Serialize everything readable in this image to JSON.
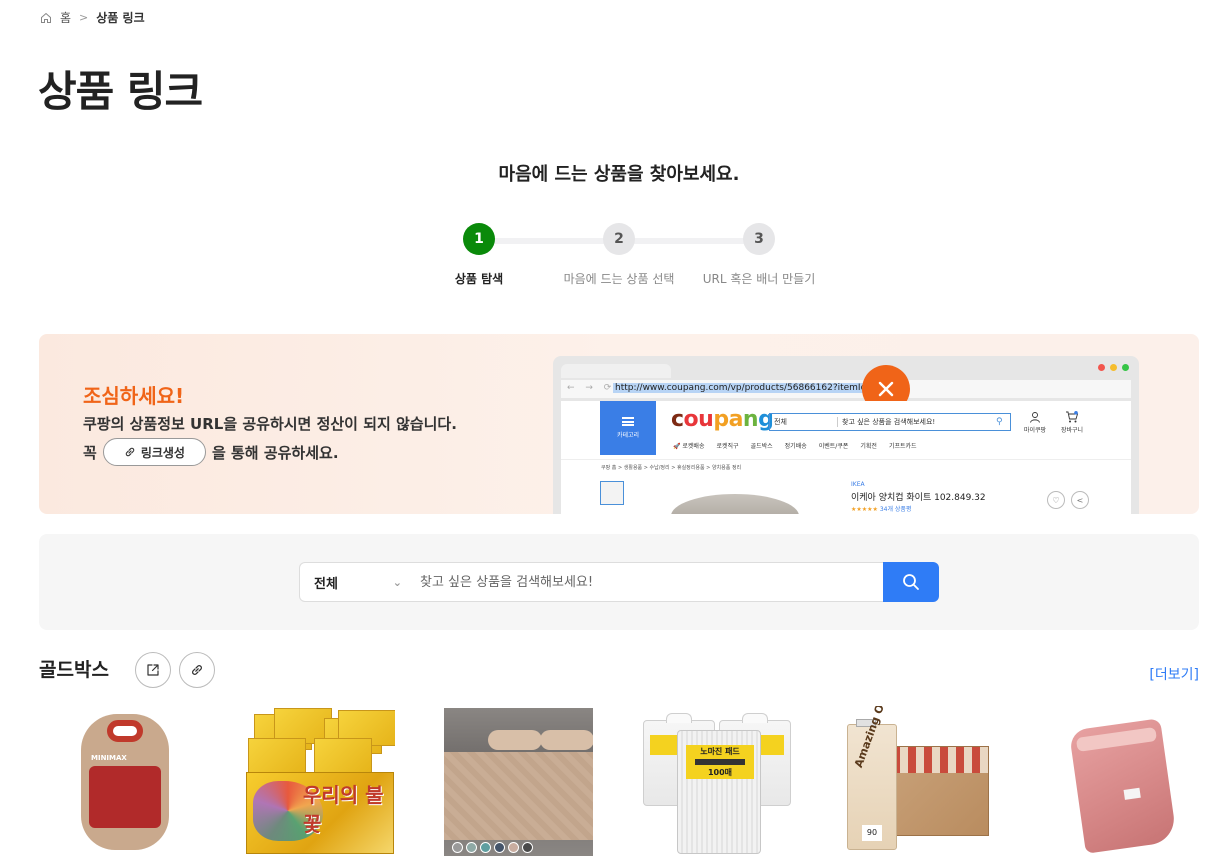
{
  "breadcrumb": {
    "home": "홈",
    "current": "상품 링크"
  },
  "page_title": "상품 링크",
  "subtitle": "마음에 드는 상품을 찾아보세요.",
  "steps": [
    {
      "number": "1",
      "label": "상품 탐색",
      "active": true
    },
    {
      "number": "2",
      "label": "마음에 드는 상품 선택",
      "active": false
    },
    {
      "number": "3",
      "label": "URL 혹은 배너 만들기",
      "active": false
    }
  ],
  "colors": {
    "accent": "#2f7cf6",
    "step_active": "#0a8a0a",
    "warning": "#f06418"
  },
  "warning_banner": {
    "title": "조심하세요!",
    "text": "쿠팡의 상품정보 URL을 공유하시면 정산이 되지 않습니다.",
    "prefix": "꼭",
    "button_label": "링크생성",
    "suffix": "을 통해 공유하세요.",
    "browser": {
      "url": "http://www.coupang.com/vp/products/56866162?itemId",
      "nav_icons": "← → ⟳",
      "category_label": "카테고리",
      "logo_parts": [
        "c",
        "ou",
        "pa",
        "n",
        "g"
      ],
      "search_category": "전체",
      "search_placeholder": "찾고 싶은 상품을 검색해보세요!",
      "my_label": "마이쿠팡",
      "cart_label": "장바구니",
      "cart_badge": "1",
      "menu": [
        "🚀 로켓배송",
        "로켓직구",
        "골드박스",
        "정기배송",
        "이벤트/쿠폰",
        "기획전",
        "기프트카드"
      ],
      "crumb": "쿠팡 홈 > 생활용품 > 수납/정리 > 휴실정리용품 > 양치용품 정리",
      "brand": "IKEA",
      "product_name": "이케아 양치컵 화이트 102.849.32",
      "rating_stars": "★★★★★",
      "review_count": "34개 상품평"
    }
  },
  "search": {
    "category": "전체",
    "placeholder": "찾고 싶은 상품을 검색해보세요!"
  },
  "section": {
    "title": "골드박스",
    "more_label": "[더보기]"
  },
  "products": [
    {
      "name": "product-1",
      "icon": "minimax-gummy-bottle",
      "text": "MINIMAX"
    },
    {
      "name": "product-2",
      "icon": "hand-warmer-pack",
      "text": "우리의 불꽃"
    },
    {
      "name": "product-3",
      "icon": "quilted-mattress-pad"
    },
    {
      "name": "product-4",
      "icon": "pad-packs",
      "text": "노마진 패드",
      "count": "100매"
    },
    {
      "name": "product-5",
      "icon": "oat-drink",
      "text": "Amazing Oat",
      "badge": "90"
    },
    {
      "name": "product-6",
      "icon": "pink-blanket"
    }
  ]
}
